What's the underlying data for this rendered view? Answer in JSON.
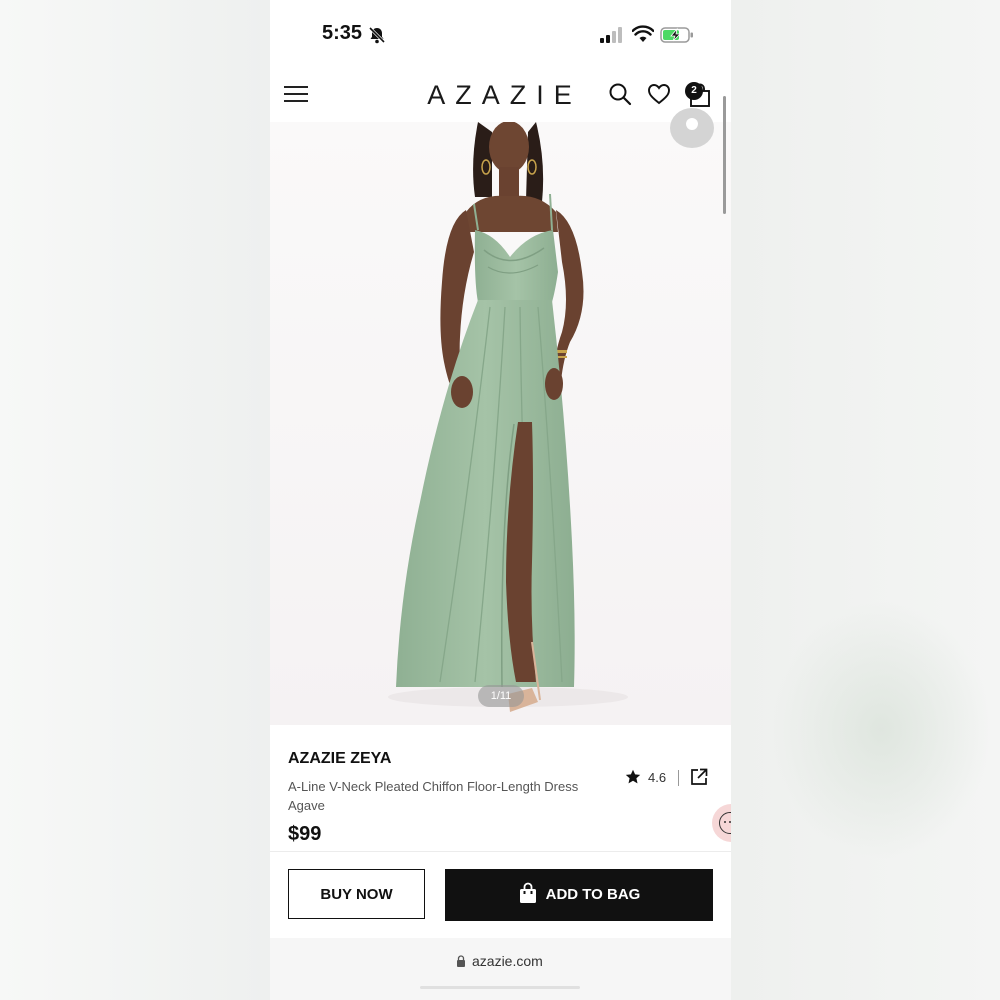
{
  "status_bar": {
    "time": "5:35"
  },
  "header": {
    "logo": "AZAZIE",
    "cart_count": "2"
  },
  "gallery": {
    "counter": "1/11"
  },
  "product": {
    "brand": "AZAZIE ZEYA",
    "name": "A-Line V-Neck Pleated Chiffon Floor-Length Dress",
    "color": "Agave",
    "rating": "4.6",
    "price": "$99"
  },
  "actions": {
    "buy_now": "BUY NOW",
    "add_to_bag": "ADD TO BAG"
  },
  "browser": {
    "url": "azazie.com"
  },
  "colors": {
    "dress": "#9dbb9f",
    "accent": "#111111"
  }
}
